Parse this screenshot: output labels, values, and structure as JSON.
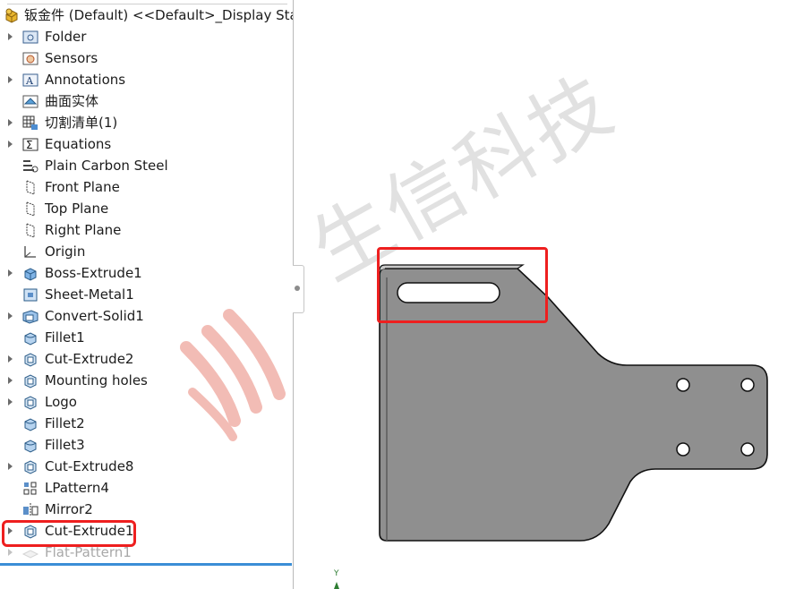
{
  "tree": {
    "root": {
      "label": "钣金件 (Default) <<Default>_Display State",
      "icon": "part-icon"
    },
    "items": [
      {
        "label": "Folder",
        "icon": "folder-icon",
        "expandable": true
      },
      {
        "label": "Sensors",
        "icon": "sensor-icon",
        "expandable": false
      },
      {
        "label": "Annotations",
        "icon": "annotations-icon",
        "expandable": true
      },
      {
        "label": "曲面实体",
        "icon": "surface-bodies-icon",
        "expandable": false
      },
      {
        "label": "切割清单(1)",
        "icon": "cut-list-icon",
        "expandable": true
      },
      {
        "label": "Equations",
        "icon": "equations-icon",
        "expandable": true
      },
      {
        "label": "Plain Carbon Steel",
        "icon": "material-icon",
        "expandable": false
      },
      {
        "label": "Front Plane",
        "icon": "plane-icon",
        "expandable": false
      },
      {
        "label": "Top Plane",
        "icon": "plane-icon",
        "expandable": false
      },
      {
        "label": "Right Plane",
        "icon": "plane-icon",
        "expandable": false
      },
      {
        "label": "Origin",
        "icon": "origin-icon",
        "expandable": false
      },
      {
        "label": "Boss-Extrude1",
        "icon": "boss-extrude-icon",
        "expandable": true
      },
      {
        "label": "Sheet-Metal1",
        "icon": "sheet-metal-icon",
        "expandable": false
      },
      {
        "label": "Convert-Solid1",
        "icon": "convert-solid-icon",
        "expandable": true
      },
      {
        "label": "Fillet1",
        "icon": "fillet-icon",
        "expandable": false
      },
      {
        "label": "Cut-Extrude2",
        "icon": "cut-extrude-icon",
        "expandable": true
      },
      {
        "label": "Mounting holes",
        "icon": "cut-extrude-icon",
        "expandable": true
      },
      {
        "label": "Logo",
        "icon": "cut-extrude-icon",
        "expandable": true
      },
      {
        "label": "Fillet2",
        "icon": "fillet-icon",
        "expandable": false
      },
      {
        "label": "Fillet3",
        "icon": "fillet-icon",
        "expandable": false
      },
      {
        "label": "Cut-Extrude8",
        "icon": "cut-extrude-icon",
        "expandable": true
      },
      {
        "label": "LPattern4",
        "icon": "linear-pattern-icon",
        "expandable": false
      },
      {
        "label": "Mirror2",
        "icon": "mirror-icon",
        "expandable": false
      },
      {
        "label": "Cut-Extrude1",
        "icon": "cut-extrude-icon",
        "expandable": true
      },
      {
        "label": "Flat-Pattern1",
        "icon": "flat-pattern-icon",
        "expandable": true,
        "suppressed": true
      }
    ]
  },
  "viewport": {
    "watermark": "生信科技",
    "axis_label": "Y",
    "part_color": "#8f8f8f",
    "highlight_color": "#ee1f1f"
  }
}
